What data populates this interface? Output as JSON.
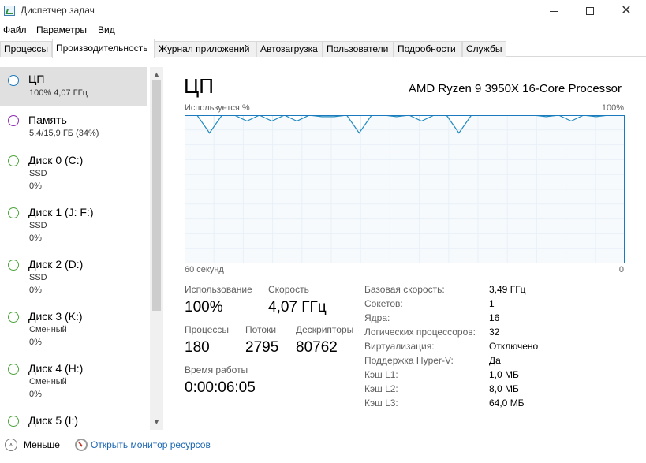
{
  "window": {
    "title": "Диспетчер задач",
    "close_glyph": "✕"
  },
  "menu": [
    "Файл",
    "Параметры",
    "Вид"
  ],
  "tabs": [
    "Процессы",
    "Производительность",
    "Журнал приложений",
    "Автозагрузка",
    "Пользователи",
    "Подробности",
    "Службы"
  ],
  "active_tab": 1,
  "sidebar": {
    "items": [
      {
        "title": "ЦП",
        "sub1": "100% 4,07 ГГц",
        "sub2": "",
        "color": "#1a7abd"
      },
      {
        "title": "Память",
        "sub1": "5,4/15,9 ГБ (34%)",
        "sub2": "",
        "color": "#8b2ab3"
      },
      {
        "title": "Диск 0 (C:)",
        "sub1": "SSD",
        "sub2": "0%",
        "color": "#4ca53a"
      },
      {
        "title": "Диск 1 (J: F:)",
        "sub1": "SSD",
        "sub2": "0%",
        "color": "#4ca53a"
      },
      {
        "title": "Диск 2 (D:)",
        "sub1": "SSD",
        "sub2": "0%",
        "color": "#4ca53a"
      },
      {
        "title": "Диск 3 (K:)",
        "sub1": "Сменный",
        "sub2": "0%",
        "color": "#4ca53a"
      },
      {
        "title": "Диск 4 (H:)",
        "sub1": "Сменный",
        "sub2": "0%",
        "color": "#4ca53a"
      },
      {
        "title": "Диск 5 (I:)",
        "sub1": "",
        "sub2": "",
        "color": "#4ca53a"
      }
    ],
    "scroll_up_glyph": "▲",
    "scroll_down_glyph": "▼"
  },
  "main": {
    "title": "ЦП",
    "cpu_model": "AMD Ryzen 9 3950X 16-Core Processor",
    "graph_label_top_left": "Используется %",
    "graph_label_top_right": "100%",
    "graph_label_bottom_left": "60 секунд",
    "graph_label_bottom_right": "0",
    "stats": {
      "usage_label": "Использование",
      "usage_value": "100%",
      "speed_label": "Скорость",
      "speed_value": "4,07 ГГц",
      "processes_label": "Процессы",
      "processes_value": "180",
      "threads_label": "Потоки",
      "threads_value": "2795",
      "handles_label": "Дескрипторы",
      "handles_value": "80762",
      "uptime_label": "Время работы",
      "uptime_value": "0:00:06:05"
    },
    "specs": [
      {
        "label": "Базовая скорость:",
        "value": "3,49 ГГц"
      },
      {
        "label": "Сокетов:",
        "value": "1"
      },
      {
        "label": "Ядра:",
        "value": "16"
      },
      {
        "label": "Логических процессоров:",
        "value": "32"
      },
      {
        "label": "Виртуализация:",
        "value": "Отключено"
      },
      {
        "label": "Поддержка Hyper-V:",
        "value": "Да"
      },
      {
        "label": "Кэш L1:",
        "value": "1,0 МБ"
      },
      {
        "label": "Кэш L2:",
        "value": "8,0 МБ"
      },
      {
        "label": "Кэш L3:",
        "value": "64,0 МБ"
      }
    ]
  },
  "footer": {
    "less_label": "Меньше",
    "less_glyph": "˄",
    "monitor_label": "Открыть монитор ресурсов"
  },
  "colors": {
    "accent": "#1a7abd",
    "graph_fill": "#f1f6fb",
    "graph_line": "#1f8ac0",
    "grid": "#d9e6f2",
    "link": "#1a66b3"
  },
  "chart_data": {
    "type": "line",
    "xlabel": "60 секунд",
    "ylabel": "Используется %",
    "ylim": [
      0,
      100
    ],
    "xlim": [
      0,
      60
    ],
    "x": [
      0,
      1.7,
      3.4,
      5.1,
      6.8,
      8.5,
      10.2,
      11.9,
      13.6,
      15.3,
      17.0,
      18.7,
      20.4,
      22.1,
      23.8,
      25.5,
      27.2,
      28.9,
      30.6,
      32.3,
      34.0,
      35.7,
      37.4,
      39.1,
      40.8,
      42.5,
      44.2,
      45.9,
      47.6,
      49.3,
      51.0,
      52.7,
      54.4,
      56.1,
      57.8,
      60
    ],
    "values": [
      100,
      100,
      88,
      100,
      100,
      96,
      100,
      96,
      100,
      96,
      100,
      99,
      99,
      100,
      88,
      100,
      100,
      99,
      100,
      96,
      100,
      100,
      88,
      100,
      100,
      100,
      100,
      100,
      100,
      99,
      100,
      96,
      100,
      99,
      100,
      100
    ],
    "grid": true
  }
}
